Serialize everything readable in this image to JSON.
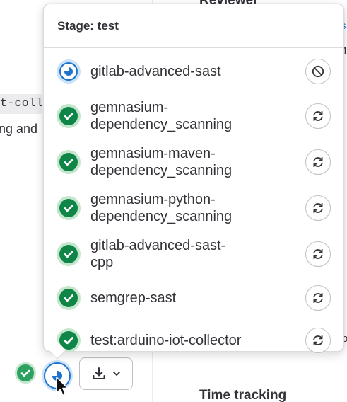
{
  "background": {
    "reviewer_heading": "Reviewer",
    "right_link_fragment": "s",
    "right_char_fragment": "1",
    "right_char_fragment_2": "o",
    "code_fragment": "t-coll",
    "text_fragment": "ng and",
    "time_tracking_heading": "Time tracking"
  },
  "dropdown": {
    "title": "Stage: test",
    "jobs": [
      {
        "name": "gitlab-advanced-sast",
        "status": "running",
        "action": "cancel"
      },
      {
        "name": "gemnasium-\ndependency_scanning",
        "status": "success",
        "action": "retry"
      },
      {
        "name": "gemnasium-maven-\ndependency_scanning",
        "status": "success",
        "action": "retry"
      },
      {
        "name": "gemnasium-python-\ndependency_scanning",
        "status": "success",
        "action": "retry"
      },
      {
        "name": "gitlab-advanced-sast-\ncpp",
        "status": "success",
        "action": "retry"
      },
      {
        "name": "semgrep-sast",
        "status": "success",
        "action": "retry"
      },
      {
        "name": "test:arduino-iot-collector",
        "status": "success",
        "action": "retry"
      }
    ]
  },
  "colors": {
    "success": "#108548",
    "running": "#1f75cb",
    "border": "#dcdcde"
  }
}
